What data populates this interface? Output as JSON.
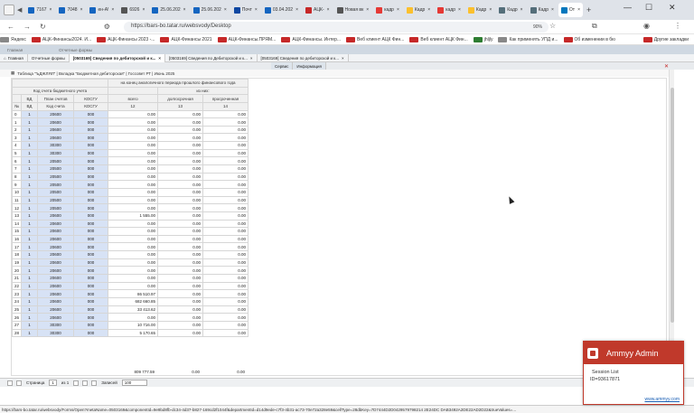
{
  "browser": {
    "tabs": [
      {
        "label": "7167",
        "color": "#1565c0"
      },
      {
        "label": "7048",
        "color": "#1565c0"
      },
      {
        "label": "ен-А!",
        "color": "#1565c0"
      },
      {
        "label": "6926",
        "color": "#555"
      },
      {
        "label": "25.06.202",
        "color": "#1565c0"
      },
      {
        "label": "25.06.202",
        "color": "#1565c0"
      },
      {
        "label": "Почт",
        "color": "#0d47a1"
      },
      {
        "label": "03.04.202",
        "color": "#1565c0"
      },
      {
        "label": "АЦК-",
        "color": "#c62828"
      },
      {
        "label": "Новая вк",
        "color": "#555"
      },
      {
        "label": "кадр",
        "color": "#e53935"
      },
      {
        "label": "Кадр",
        "color": "#fbc02d"
      },
      {
        "label": "кадр",
        "color": "#e53935"
      },
      {
        "label": "Кадр",
        "color": "#fbc02d"
      },
      {
        "label": "Кадр",
        "color": "#546e7a"
      },
      {
        "label": "Кадр",
        "color": "#546e7a"
      },
      {
        "label": "От",
        "color": "#0277bd"
      }
    ],
    "url": "https://bars-bo.tatar.ru/websvody/Desktop",
    "zoom": "90%",
    "bookmarks": [
      "Яндекс",
      "АЦК-Финансы2024. И...",
      "АЦК-Финансы 2023 -...",
      "АЦК-Финансы 2021",
      "АЦК-Финансы.ПРЯМ...",
      "АЦК-Финансы. Интер...",
      "Веб клиент АЦК Фин...",
      "Веб клиент АЦК Фин...",
      "jhljly",
      "Как применять УПД и...",
      "Об изменении в бю",
      "Другие закладки"
    ]
  },
  "app": {
    "top_items": [
      "Главная",
      "Отчетные формы"
    ],
    "tabs": [
      "[0503169] Сведения по дебиторской и к...",
      "[0503169] Сведения по Дебиторской и к...",
      "[0503169] Сведения по дебиторской и к..."
    ],
    "sub_tabs": [
      "Главная",
      "Отчетные формы",
      "Сервис",
      "Информация"
    ],
    "breadcrumb": "Таблица \"ЪДЖЛЯЛ\" | Вкладка \"Бюджетная дебиторская\" | Госсовет РТ | Июнь 2025"
  },
  "table": {
    "period_header": "на конец аналогичного периода прошлого финансового года",
    "key_header": "Код счета бюджетного учета",
    "of_them": "из них:",
    "col_vd": "ВД",
    "col_plan": "План счетов",
    "col_kosgu": "КОСГУ",
    "col_nr": "№",
    "col_kod_scheta": "Код счета",
    "col_total": "всего",
    "col_contract": "долгосрочная",
    "col_overdue": "просроченная",
    "col_n12": "12",
    "col_n13": "13",
    "col_n14": "14",
    "rows": [
      [
        "0",
        "1",
        "20600",
        "000",
        "0.00",
        "0.00",
        "0.00"
      ],
      [
        "1",
        "1",
        "20600",
        "000",
        "0.00",
        "0.00",
        "0.00"
      ],
      [
        "2",
        "1",
        "20600",
        "000",
        "0.00",
        "0.00",
        "0.00"
      ],
      [
        "3",
        "1",
        "20600",
        "000",
        "0.00",
        "0.00",
        "0.00"
      ],
      [
        "4",
        "1",
        "30300",
        "000",
        "0.00",
        "0.00",
        "0.00"
      ],
      [
        "5",
        "1",
        "30300",
        "000",
        "0.00",
        "0.00",
        "0.00"
      ],
      [
        "6",
        "1",
        "20500",
        "000",
        "0.00",
        "0.00",
        "0.00"
      ],
      [
        "7",
        "1",
        "20500",
        "000",
        "0.00",
        "0.00",
        "0.00"
      ],
      [
        "8",
        "1",
        "20500",
        "000",
        "0.00",
        "0.00",
        "0.00"
      ],
      [
        "9",
        "1",
        "20500",
        "000",
        "0.00",
        "0.00",
        "0.00"
      ],
      [
        "10",
        "1",
        "20500",
        "000",
        "0.00",
        "0.00",
        "0.00"
      ],
      [
        "11",
        "1",
        "20500",
        "000",
        "0.00",
        "0.00",
        "0.00"
      ],
      [
        "12",
        "1",
        "20500",
        "000",
        "0.00",
        "0.00",
        "0.00"
      ],
      [
        "13",
        "1",
        "20600",
        "000",
        "1 555.00",
        "0.00",
        "0.00"
      ],
      [
        "14",
        "1",
        "20600",
        "000",
        "0.00",
        "0.00",
        "0.00"
      ],
      [
        "15",
        "1",
        "20600",
        "000",
        "0.00",
        "0.00",
        "0.00"
      ],
      [
        "16",
        "1",
        "20600",
        "000",
        "0.00",
        "0.00",
        "0.00"
      ],
      [
        "17",
        "1",
        "20600",
        "000",
        "0.00",
        "0.00",
        "0.00"
      ],
      [
        "18",
        "1",
        "20600",
        "000",
        "0.00",
        "0.00",
        "0.00"
      ],
      [
        "19",
        "1",
        "20600",
        "000",
        "0.00",
        "0.00",
        "0.00"
      ],
      [
        "20",
        "1",
        "20600",
        "000",
        "0.00",
        "0.00",
        "0.00"
      ],
      [
        "21",
        "1",
        "20600",
        "000",
        "0.00",
        "0.00",
        "0.00"
      ],
      [
        "22",
        "1",
        "20600",
        "000",
        "0.00",
        "0.00",
        "0.00"
      ],
      [
        "23",
        "1",
        "20600",
        "000",
        "86 510.97",
        "0.00",
        "0.00"
      ],
      [
        "24",
        "1",
        "20600",
        "000",
        "682 660.85",
        "0.00",
        "0.00"
      ],
      [
        "25",
        "1",
        "20600",
        "000",
        "33 413.62",
        "0.00",
        "0.00"
      ],
      [
        "26",
        "1",
        "20600",
        "000",
        "0.00",
        "0.00",
        "0.00"
      ],
      [
        "27",
        "1",
        "30300",
        "000",
        "10 716.00",
        "0.00",
        "0.00"
      ],
      [
        "28",
        "1",
        "30300",
        "000",
        "5 170.65",
        "0.00",
        "0.00"
      ]
    ],
    "total_all": "809 777.59",
    "total_contract": "0.00",
    "total_overdue": "0.00"
  },
  "pager": {
    "page_label": "Страница",
    "page_value": "1",
    "of_label": "из 1",
    "rows_label": "Записей",
    "rows_value": "100"
  },
  "status_url": "https://bars-bo.tatar.ru/websvody/Forms/Open?metaName=0503169&componentId=9e9bd8fb-dc34-4d37-b827-169cd2f1044f&departmentId=d14d9ede-c7f3-4b31-ac73-70e72a328e59&cellType=28dbKey=7D7444D2D0429579798214 2E24DC DAB3492A2DE22AD2D22&trueValues=...",
  "ammyy": {
    "title": "Ammyy Admin",
    "session": "Session List",
    "id": "ID=93617871",
    "site": "www.ammyy.com"
  }
}
